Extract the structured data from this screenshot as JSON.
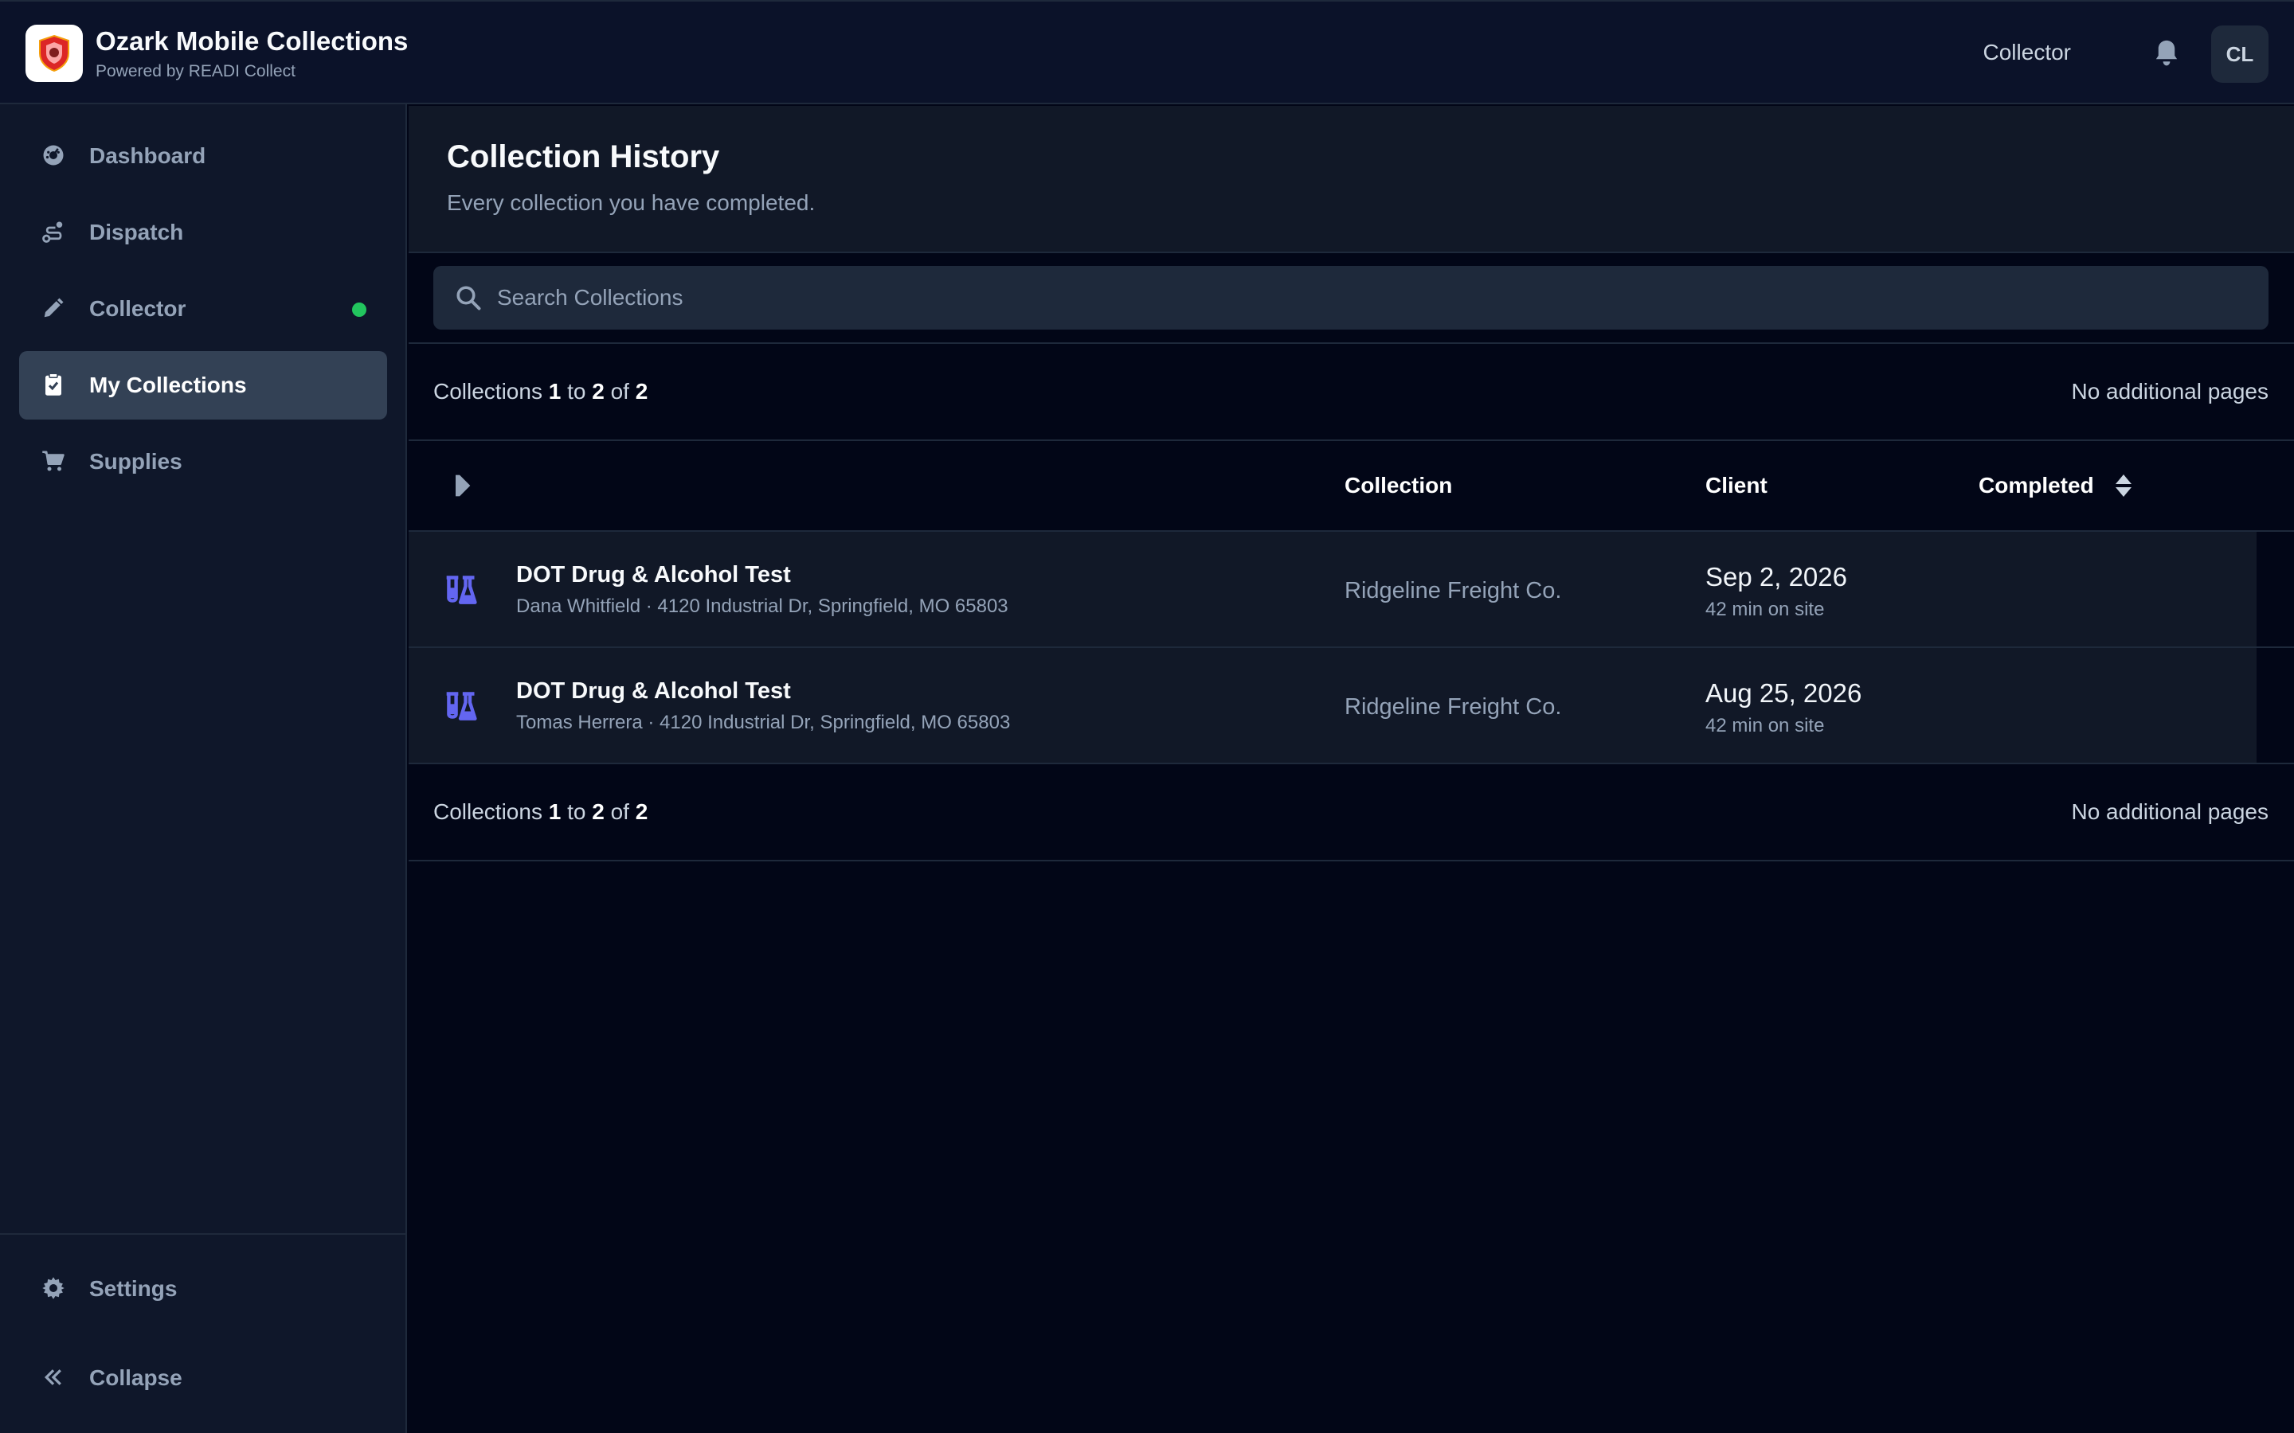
{
  "header": {
    "app_title": "Ozark Mobile Collections",
    "app_subtitle": "Powered by READI Collect",
    "role": "Collector",
    "avatar_initials": "CL"
  },
  "sidebar": {
    "items": [
      {
        "label": "Dashboard",
        "icon": "gauge-icon"
      },
      {
        "label": "Dispatch",
        "icon": "route-icon"
      },
      {
        "label": "Collector",
        "icon": "pen-icon",
        "status": "online"
      },
      {
        "label": "My Collections",
        "icon": "clipboard-check-icon",
        "active": true
      },
      {
        "label": "Supplies",
        "icon": "cart-icon"
      }
    ],
    "footer": [
      {
        "label": "Settings",
        "icon": "gear-icon"
      },
      {
        "label": "Collapse",
        "icon": "double-chevron-left-icon"
      }
    ]
  },
  "page": {
    "title": "Collection History",
    "subtitle": "Every collection you have completed."
  },
  "search": {
    "placeholder": "Search Collections",
    "value": ""
  },
  "pagination": {
    "prefix": "Collections",
    "from": "1",
    "to_word": "to",
    "to": "2",
    "of_word": "of",
    "total": "2",
    "pages_note": "No additional pages"
  },
  "table": {
    "columns": [
      "Collection",
      "Client",
      "Completed"
    ],
    "rows": [
      {
        "title": "DOT Drug & Alcohol Test",
        "subtitle": "Dana Whitfield · 4120 Industrial Dr, Springfield, MO 65803",
        "client": "Ridgeline Freight Co.",
        "date": "Sep 2, 2026",
        "duration": "42 min on site"
      },
      {
        "title": "DOT Drug & Alcohol Test",
        "subtitle": "Tomas Herrera · 4120 Industrial Dr, Springfield, MO 65803",
        "client": "Ridgeline Freight Co.",
        "date": "Aug 25, 2026",
        "duration": "42 min on site"
      }
    ]
  },
  "colors": {
    "background": "#020617",
    "sidebar": "#0f172a",
    "active_nav": "#334155",
    "accent_icon": "#6366f1",
    "status_online": "#22c55e"
  }
}
